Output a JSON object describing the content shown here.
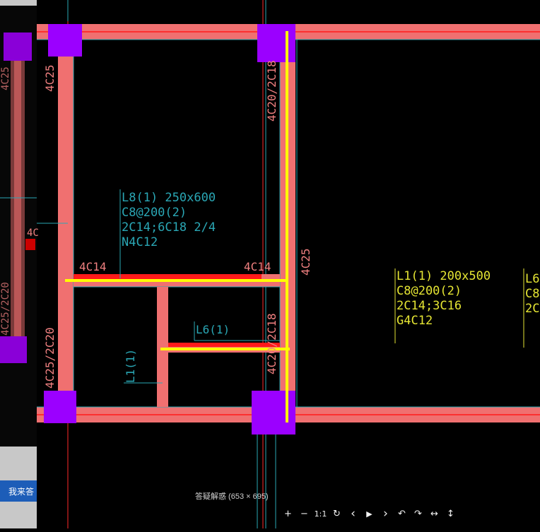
{
  "viewer": {
    "caption": "答疑解惑 (653 × 695)"
  },
  "page": {
    "answer_button_label": "我来答"
  },
  "drawing": {
    "beams": [
      {
        "id": "L8",
        "lines": [
          "L8(1) 250x600",
          "C8@200(2)",
          "2C14;6C18 2/4",
          "N4C12"
        ]
      },
      {
        "id": "L1-right",
        "lines": [
          "L1(1) 200x500",
          "C8@200(2)",
          "2C14;3C16",
          "G4C12"
        ]
      },
      {
        "id": "L6",
        "lines": [
          "L6(1)"
        ]
      },
      {
        "id": "L1-vertical",
        "lines": [
          "L1(1)"
        ]
      }
    ],
    "rebar_labels": {
      "top_left_vertical": "4C25",
      "top_mid_vertical": "4C20/2C18",
      "right_vertical": "4C25",
      "left_lower_vertical": "4C25/2C20",
      "mid_lower_vertical": "4C20/2C18",
      "beam_left": "4C14",
      "beam_right": "4C14",
      "edge_left_top": "4C25",
      "edge_left_bottom": "4C25/2C20",
      "edge_left_partial": "4C",
      "far_right_partial_1": "L6",
      "far_right_partial_2": "C8",
      "far_right_partial_3": "2C"
    },
    "colors": {
      "background": "#000000",
      "beam_fill": "#f07070",
      "beam_red": "#ff1a1a",
      "column": "#9b00ff",
      "highlight": "#ffff00",
      "text_cyan": "#2aa7b5",
      "text_yellow": "#e5e533",
      "text_salmon": "#f08080"
    }
  },
  "toolbar": {
    "items": [
      {
        "name": "zoom-in-icon",
        "glyph": "+"
      },
      {
        "name": "zoom-out-icon",
        "glyph": "−"
      },
      {
        "name": "actual-size-icon",
        "glyph": "1:1"
      },
      {
        "name": "refresh-icon",
        "glyph": "↻"
      },
      {
        "name": "prev-icon",
        "glyph": "‹"
      },
      {
        "name": "play-icon",
        "glyph": "▶"
      },
      {
        "name": "next-icon",
        "glyph": "›"
      },
      {
        "name": "rotate-left-icon",
        "glyph": "↶"
      },
      {
        "name": "rotate-right-icon",
        "glyph": "↷"
      },
      {
        "name": "flip-horizontal-icon",
        "glyph": "↔"
      },
      {
        "name": "flip-vertical-icon",
        "glyph": "↕"
      }
    ]
  }
}
